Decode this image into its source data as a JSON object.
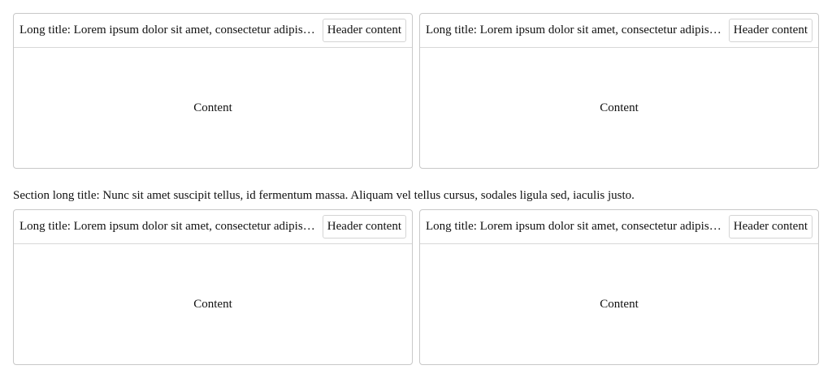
{
  "section_1": {
    "cards": [
      {
        "title": "Long title: Lorem ipsum dolor sit amet, consectetur adipiscing elit. Sed do eiusmod tempor",
        "header_action": "Header content",
        "body": "Content"
      },
      {
        "title": "Long title: Lorem ipsum dolor sit amet, consectetur adipiscing elit. Sed do eiusmod tempor",
        "header_action": "Header content",
        "body": "Content"
      }
    ]
  },
  "section_2": {
    "title": "Section long title: Nunc sit amet suscipit tellus, id fermentum massa. Aliquam vel tellus cursus, sodales ligula sed, iaculis justo.",
    "cards": [
      {
        "title": "Long title: Lorem ipsum dolor sit amet, consectetur adipiscing elit. Sed do eiusmod tempor",
        "header_action": "Header content",
        "body": "Content"
      },
      {
        "title": "Long title: Lorem ipsum dolor sit amet, consectetur adipiscing elit. Sed do eiusmod tempor",
        "header_action": "Header content",
        "body": "Content"
      }
    ]
  }
}
